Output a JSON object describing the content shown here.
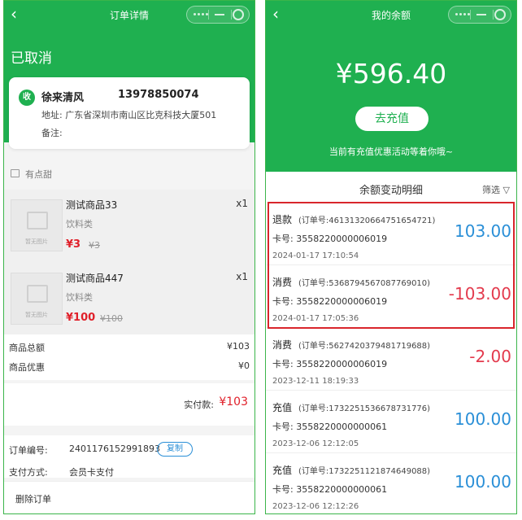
{
  "order": {
    "nav_title": "订单详情",
    "status": "已取消",
    "receiver": {
      "badge": "收",
      "name": "徐来清风",
      "phone": "13978850074",
      "address": "地址: 广东省深圳市南山区比克科技大厦501",
      "note": "备注:"
    },
    "shop_name": "有点甜",
    "image_placeholder": "暂无图片",
    "products": [
      {
        "name": "测试商品33",
        "category": "饮料类",
        "price": "¥3",
        "original_price": "¥3",
        "qty": "x1"
      },
      {
        "name": "测试商品447",
        "category": "饮料类",
        "price": "¥100",
        "original_price": "¥100",
        "qty": "x1"
      }
    ],
    "summary": {
      "total_label": "商品总额",
      "total_value": "¥103",
      "discount_label": "商品优惠",
      "discount_value": "¥0"
    },
    "paid": {
      "label": "实付款:",
      "value": "¥103"
    },
    "info": {
      "order_no_label": "订单编号:",
      "order_no": "2401176152991893",
      "copy_label": "复制",
      "pay_label": "支付方式:",
      "pay_method": "会员卡支付"
    },
    "delete_label": "删除订单"
  },
  "balance": {
    "nav_title": "我的余额",
    "amount": "¥596.40",
    "recharge_label": "去充值",
    "promo_text": "当前有充值优惠活动等着你哦~",
    "detail_title": "余额变动明细",
    "filter_label": "筛选",
    "highlight_color": "#d9262c",
    "records": [
      {
        "type": "退款",
        "order": "(订单号:46131320664751654721)",
        "card": "卡号: 3558220000006019",
        "time": "2024-01-17 17:10:54",
        "amount": "103.00",
        "sign": "positive"
      },
      {
        "type": "消费",
        "order": "(订单号:53687945670877690​10)",
        "card": "卡号: 3558220000006019",
        "time": "2024-01-17 17:05:36",
        "amount": "-103.00",
        "sign": "negative"
      },
      {
        "type": "消费",
        "order": "(订单号:56274203794817196​88)",
        "card": "卡号: 3558220000006019",
        "time": "2023-12-11 18:19:33",
        "amount": "-2.00",
        "sign": "negative"
      },
      {
        "type": "充值",
        "order": "(订单号:17322515366787317​76)",
        "card": "卡号: 3558220000000061",
        "time": "2023-12-06 12:12:05",
        "amount": "100.00",
        "sign": "positive"
      },
      {
        "type": "充值",
        "order": "(订单号:17322511218746490​88)",
        "card": "卡号: 3558220000000061",
        "time": "2023-12-06 12:12:26",
        "amount": "100.00",
        "sign": "positive"
      }
    ]
  },
  "colors": {
    "brand_green": "#1fb050",
    "price_red": "#e0202a",
    "positive_blue": "#2a8fd7",
    "negative_red": "#e33a4d"
  }
}
